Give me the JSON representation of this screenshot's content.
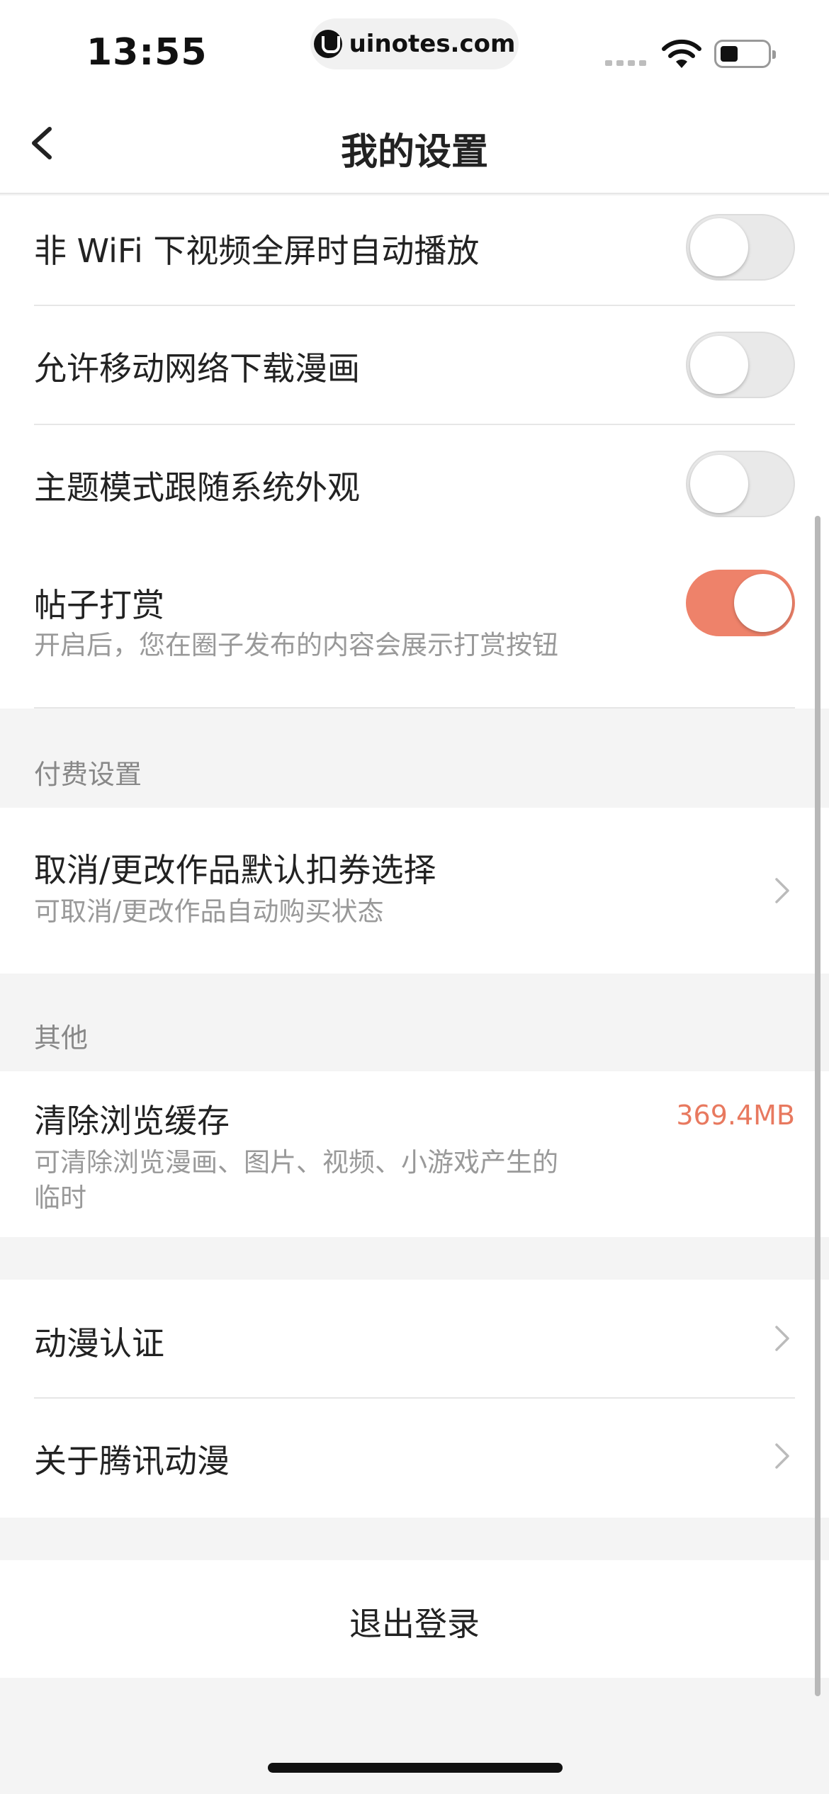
{
  "status_bar": {
    "time": "13:55",
    "url": "uinotes.com"
  },
  "nav": {
    "title": "我的设置"
  },
  "settings": [
    {
      "title": "非 WiFi 下视频全屏时自动播放",
      "toggle_on": false
    },
    {
      "title": "允许移动网络下载漫画",
      "toggle_on": false
    },
    {
      "title": "主题模式跟随系统外观",
      "toggle_on": false
    },
    {
      "title": "帖子打赏",
      "subtitle": "开启后，您在圈子发布的内容会展示打赏按钮",
      "toggle_on": true
    }
  ],
  "paid_section": {
    "header": "付费设置",
    "item": {
      "title": "取消/更改作品默认扣券选择",
      "subtitle": "可取消/更改作品自动购买状态"
    }
  },
  "other_section": {
    "header": "其他",
    "cache": {
      "title": "清除浏览缓存",
      "subtitle_line1": "可清除浏览漫画、图片、视频、小游戏产生的",
      "subtitle_line2": "临时",
      "size": "369.4MB"
    }
  },
  "links": [
    {
      "title": "动漫认证"
    },
    {
      "title": "关于腾讯动漫"
    }
  ],
  "logout_label": "退出登录",
  "colors": {
    "accent": "#ee826a",
    "cache_size": "#e8795f",
    "background": "#f4f4f4"
  }
}
